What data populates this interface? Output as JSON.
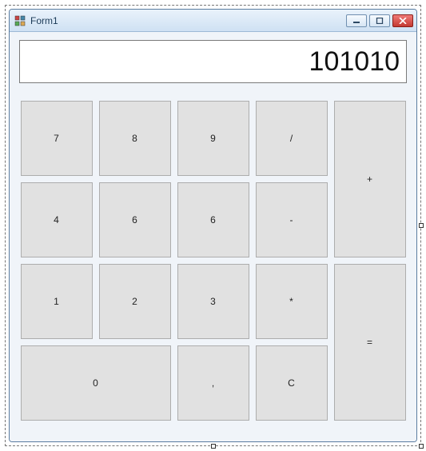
{
  "window": {
    "title": "Form1"
  },
  "display": {
    "value": "101010"
  },
  "keys": {
    "k7": "7",
    "k8": "8",
    "k9": "9",
    "div": "/",
    "k4": "4",
    "k6a": "6",
    "k6b": "6",
    "sub": "-",
    "add": "+",
    "k1": "1",
    "k2": "2",
    "k3": "3",
    "mul": "*",
    "k0": "0",
    "comma": ",",
    "clear": "C",
    "eq": "="
  }
}
